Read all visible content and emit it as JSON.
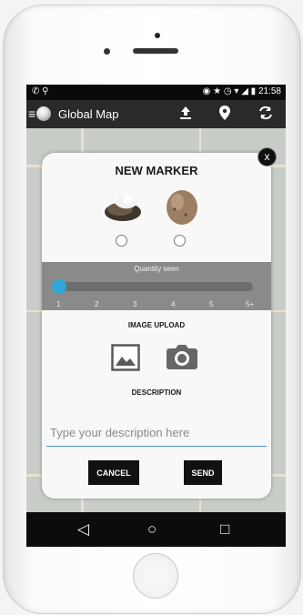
{
  "status_bar": {
    "time": "21:58"
  },
  "app_bar": {
    "menu_glyph": "≡",
    "title": "Global Map",
    "upload_icon": "upload-icon",
    "location_icon": "location-pin-icon",
    "sync_icon": "sync-icon"
  },
  "dialog": {
    "close_glyph": "x",
    "title": "NEW MARKER",
    "marker_options": [
      "marker-option-1",
      "marker-option-2"
    ],
    "quantity": {
      "label": "Quantity seen",
      "ticks": [
        "1",
        "2",
        "3",
        "4",
        "5",
        "5+"
      ],
      "selected": "1"
    },
    "image_upload_label": "IMAGE UPLOAD",
    "description_label": "DESCRIPTION",
    "description_placeholder": "Type your description here",
    "description_value": "",
    "cancel_label": "CANCEL",
    "send_label": "SEND"
  },
  "nav_bar": {
    "back": "◁",
    "home": "○",
    "recents": "□"
  },
  "colors": {
    "accent": "#2fa6d9",
    "panel": "#8a8a8a",
    "dialog": "#f8f8f8"
  }
}
